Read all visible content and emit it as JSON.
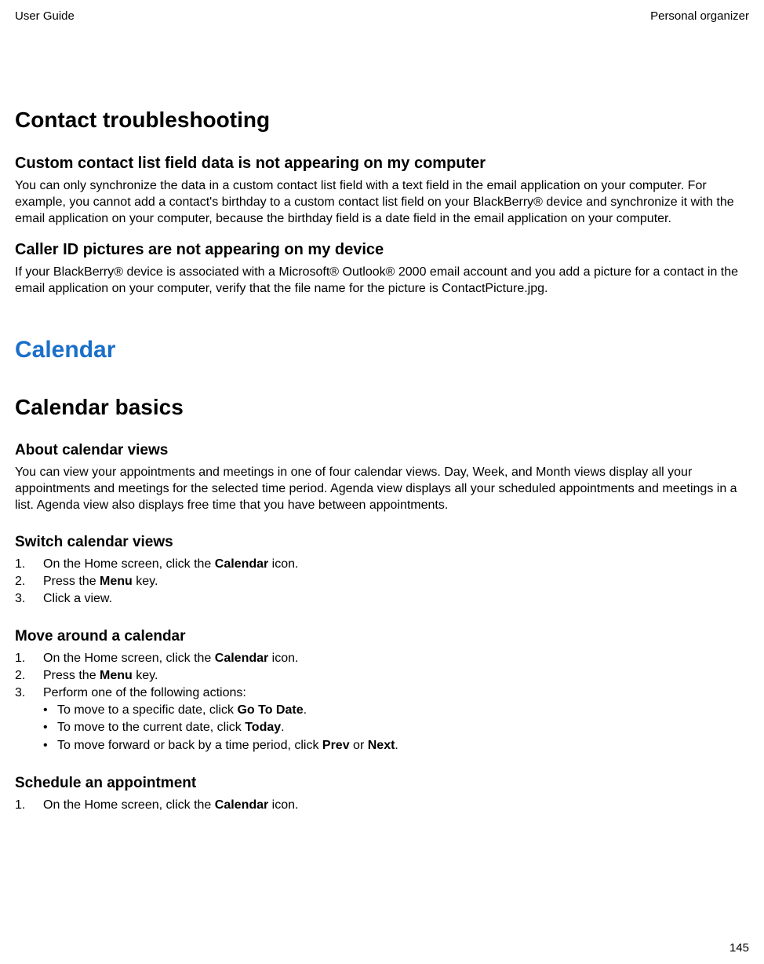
{
  "header": {
    "left": "User Guide",
    "right": "Personal organizer"
  },
  "sections": {
    "contact_troubleshooting": {
      "title": "Contact troubleshooting",
      "sub1": {
        "heading": "Custom contact list field data is not appearing on my computer",
        "body": "You can only synchronize the data in a custom contact list field with a text field in the email application on your computer. For example, you cannot add a contact's birthday to a custom contact list field on your BlackBerry® device and synchronize it with the email application on your computer, because the birthday field is a date field in the email application on your computer."
      },
      "sub2": {
        "heading": "Caller ID pictures are not appearing on my device",
        "body": "If your BlackBerry® device is associated with a Microsoft® Outlook® 2000 email account and you add a picture for a contact in the email application on your computer, verify that the file name for the picture is ContactPicture.jpg."
      }
    },
    "calendar": {
      "chapter": "Calendar",
      "basics_title": "Calendar basics",
      "about": {
        "heading": "About calendar views",
        "body": "You can view your appointments and meetings in one of four calendar views. Day, Week, and Month views display all your appointments and meetings for the selected time period. Agenda view displays all your scheduled appointments and meetings in a list. Agenda view also displays free time that you have between appointments."
      },
      "switch": {
        "heading": "Switch calendar views",
        "step1_pre": "On the Home screen, click the ",
        "step1_bold": "Calendar",
        "step1_post": " icon.",
        "step2_pre": "Press the ",
        "step2_bold": "Menu",
        "step2_post": " key.",
        "step3": "Click a view."
      },
      "move": {
        "heading": "Move around a calendar",
        "step1_pre": "On the Home screen, click the ",
        "step1_bold": "Calendar",
        "step1_post": " icon.",
        "step2_pre": "Press the ",
        "step2_bold": "Menu",
        "step2_post": " key.",
        "step3": "Perform one of the following actions:",
        "b1_pre": "To move to a specific date, click ",
        "b1_bold": "Go To Date",
        "b1_post": ".",
        "b2_pre": "To move to the current date, click ",
        "b2_bold": "Today",
        "b2_post": ".",
        "b3_pre": "To move forward or back by a time period, click ",
        "b3_bold1": "Prev",
        "b3_mid": " or ",
        "b3_bold2": "Next",
        "b3_post": "."
      },
      "schedule": {
        "heading": "Schedule an appointment",
        "step1_pre": "On the Home screen, click the ",
        "step1_bold": "Calendar",
        "step1_post": " icon."
      }
    }
  },
  "page_number": "145"
}
